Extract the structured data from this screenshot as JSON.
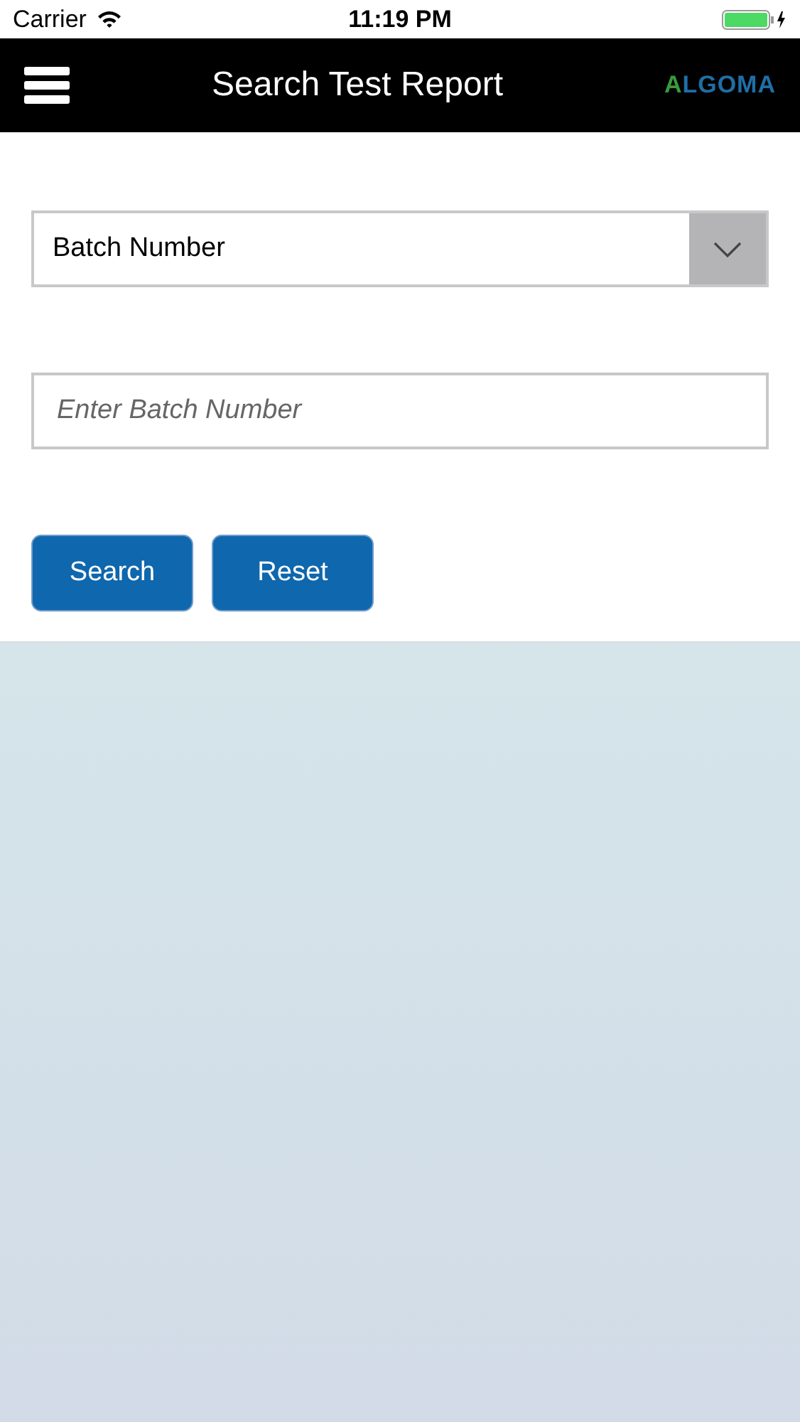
{
  "status_bar": {
    "carrier": "Carrier",
    "time": "11:19 PM"
  },
  "header": {
    "title": "Search Test Report",
    "logo": "ALGOMA"
  },
  "search_type": {
    "value": "Batch Number"
  },
  "batch_field": {
    "placeholder": "Enter Batch Number"
  },
  "buttons": [
    "Search",
    "Reset"
  ]
}
